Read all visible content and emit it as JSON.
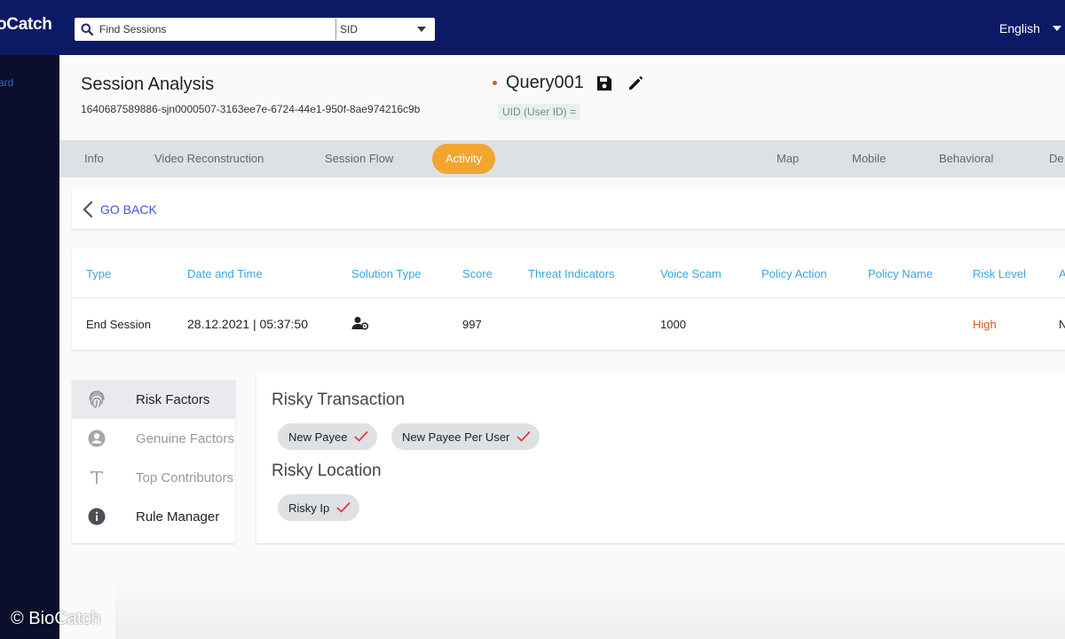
{
  "header": {
    "logo": "oCatch",
    "search_placeholder": "Find Sessions",
    "search_type": "SID",
    "language": "English"
  },
  "sidebar": {
    "item_label": "ard"
  },
  "page": {
    "title": "Session Analysis",
    "session_id": "1640687589886-sjn0000507-3163ee7e-6724-44e1-950f-8ae974216c9b",
    "query_name": "Query001",
    "uid_label": "UID (User ID) ="
  },
  "tabs": [
    {
      "label": "Info"
    },
    {
      "label": "Video Reconstruction"
    },
    {
      "label": "Session Flow"
    },
    {
      "label": "Activity"
    },
    {
      "label": "Map"
    },
    {
      "label": "Mobile"
    },
    {
      "label": "Behavioral"
    },
    {
      "label": "De"
    }
  ],
  "go_back": "GO BACK",
  "table": {
    "headers": [
      "Type",
      "Date and Time",
      "Solution Type",
      "Score",
      "Threat Indicators",
      "Voice Scam",
      "Policy Action",
      "Policy Name",
      "Risk Level",
      "A"
    ],
    "row": {
      "type": "End Session",
      "date_time": "28.12.2021 | 05:37:50",
      "solution_type_icon": "user-lock-icon",
      "score": "997",
      "threat_indicators": "",
      "voice_scam": "1000",
      "policy_action": "",
      "policy_name": "",
      "risk_level": "High",
      "last": "N"
    }
  },
  "menu": [
    {
      "label": "Risk Factors",
      "icon": "fingerprint-icon"
    },
    {
      "label": "Genuine Factors",
      "icon": "account-circle-icon"
    },
    {
      "label": "Top Contributors",
      "icon": "text-t-icon"
    },
    {
      "label": "Rule Manager",
      "icon": "info-icon"
    }
  ],
  "details": {
    "risky_transaction": {
      "title": "Risky Transaction",
      "chips": [
        "New Payee",
        "New Payee Per User"
      ]
    },
    "risky_location": {
      "title": "Risky Location",
      "chips": [
        "Risky Ip"
      ]
    }
  },
  "colors": {
    "header_bg": "#0c1a66",
    "accent_orange": "#f2a52f",
    "link_blue": "#3d5ad8",
    "header_text_blue": "#3ba7de",
    "risk_high": "#e8502a",
    "check_red": "#e23b3b"
  },
  "copyright": "© BioCatch"
}
